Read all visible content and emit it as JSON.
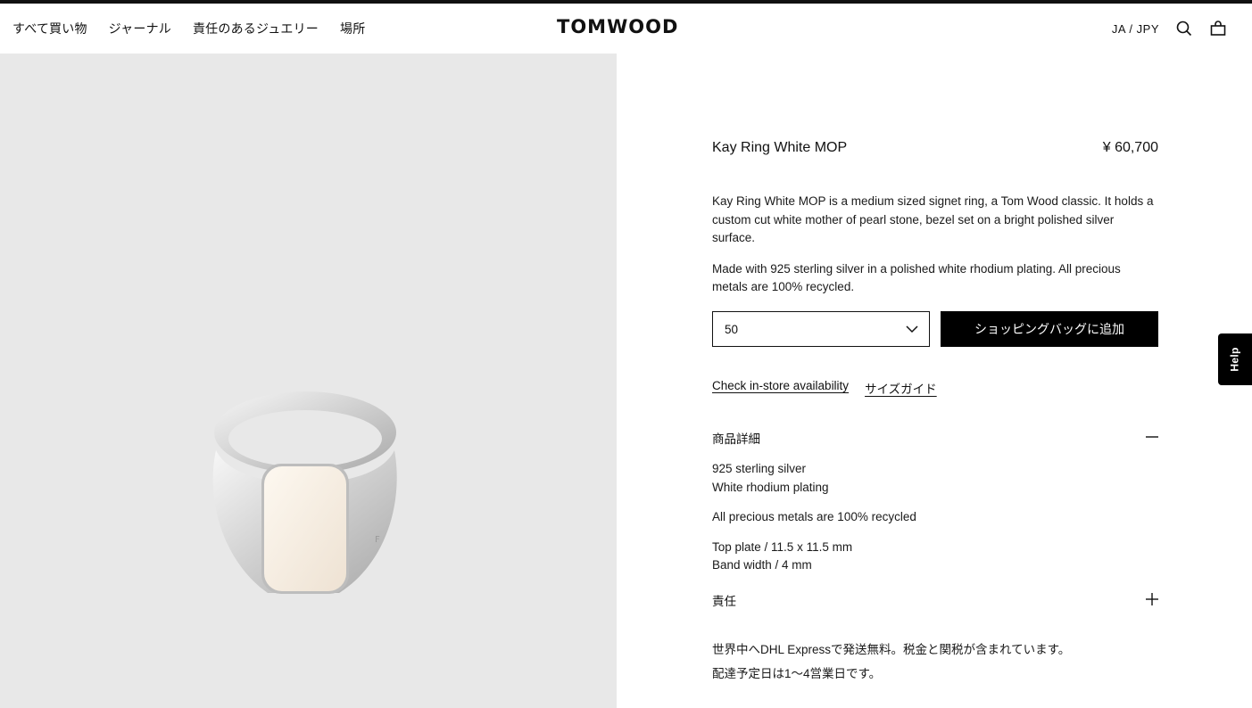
{
  "header": {
    "nav": [
      "すべて買い物",
      "ジャーナル",
      "責任のあるジュエリー",
      "場所"
    ],
    "logo": "TOMWOOD",
    "locale": "JA / JPY",
    "icons": [
      "search-icon",
      "shopping-bag-icon"
    ]
  },
  "product": {
    "name": "Kay Ring White MOP",
    "price": "¥ 60,700",
    "description": [
      "Kay Ring White MOP is a medium sized signet ring, a Tom Wood classic. It holds a custom cut white mother of pearl stone, bezel set on a bright polished silver surface.",
      "Made with 925 sterling silver in a polished white rhodium plating. All precious metals are 100% recycled."
    ],
    "size": {
      "selected": "50"
    },
    "add_to_bag": "ショッピングバッグに追加",
    "links": {
      "store": "Check in-store availability",
      "size_guide": "サイズガイド"
    }
  },
  "accordion": {
    "details_title": "商品詳細",
    "details_lines": [
      "925 sterling silver",
      "White rhodium plating",
      "All precious metals are 100% recycled",
      "Top plate / 11.5 x 11.5 mm",
      "Band width / 4 mm"
    ],
    "responsibility_title": "責任"
  },
  "shipping": {
    "line1": "世界中へDHL Expressで発送無料。税金と関税が含まれています。",
    "line2": "配達予定日は1～4営業日です。"
  },
  "help": {
    "label": "Help"
  }
}
